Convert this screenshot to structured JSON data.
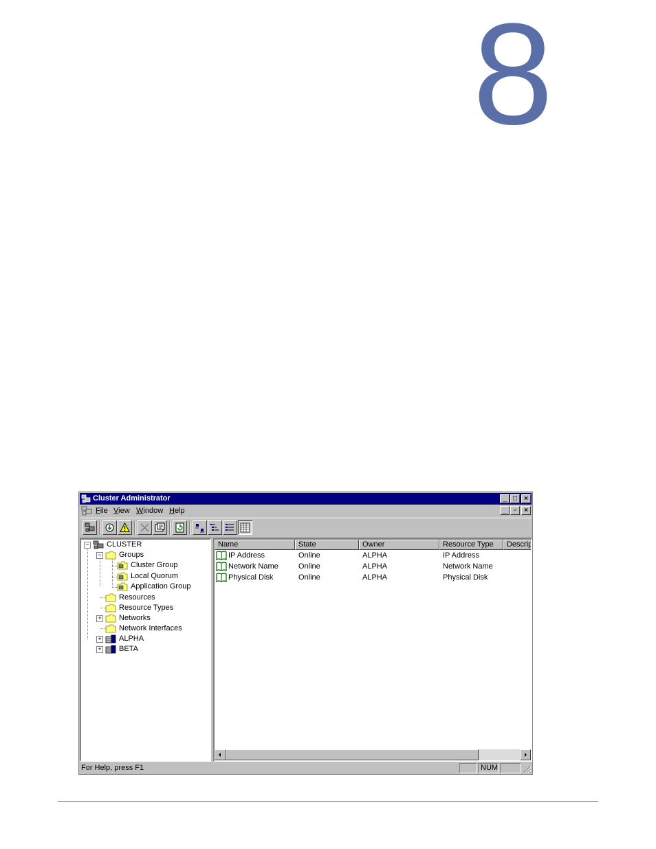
{
  "chapter": {
    "number": "8"
  },
  "window": {
    "title": "Cluster Administrator",
    "menu": [
      {
        "label": "File",
        "key": "F",
        "rest": "ile"
      },
      {
        "label": "View",
        "key": "V",
        "rest": "iew"
      },
      {
        "label": "Window",
        "key": "W",
        "rest": "indow"
      },
      {
        "label": "Help",
        "key": "H",
        "rest": "elp"
      }
    ],
    "caption_buttons": {
      "minimize": "_",
      "maximize": "□",
      "close": "×"
    },
    "mdi_buttons": {
      "minimize": "_",
      "restore": "▫",
      "close": "×"
    }
  },
  "toolbar": {
    "buttons": [
      {
        "icon": "cluster-open-icon"
      },
      {
        "icon": "bring-online-icon"
      },
      {
        "icon": "take-offline-warning-icon"
      },
      {
        "icon": "delete-icon"
      },
      {
        "icon": "properties-icon"
      },
      {
        "icon": "refresh-icon"
      },
      {
        "icon": "large-icons-view-icon"
      },
      {
        "icon": "list-view-icon"
      },
      {
        "icon": "details-tree-view-icon"
      },
      {
        "icon": "details-view-icon"
      }
    ]
  },
  "tree": {
    "root": "CLUSTER",
    "groups": "Groups",
    "group_items": [
      "Cluster Group",
      "Local Quorum",
      "Application Group"
    ],
    "resources": "Resources",
    "resource_types": "Resource Types",
    "networks": "Networks",
    "network_interfaces": "Network Interfaces",
    "nodes": [
      "ALPHA",
      "BETA"
    ]
  },
  "list": {
    "columns": [
      "Name",
      "State",
      "Owner",
      "Resource Type",
      "Descripti"
    ],
    "rows": [
      {
        "name": "IP Address",
        "state": "Online",
        "owner": "ALPHA",
        "type": "IP Address"
      },
      {
        "name": "Network Name",
        "state": "Online",
        "owner": "ALPHA",
        "type": "Network Name"
      },
      {
        "name": "Physical Disk",
        "state": "Online",
        "owner": "ALPHA",
        "type": "Physical Disk"
      }
    ]
  },
  "status": {
    "text": "For Help, press F1",
    "num": "NUM"
  },
  "colors": {
    "accent": "#5a6ea8",
    "titlebar": "#000080",
    "chrome": "#c0c0c0"
  }
}
